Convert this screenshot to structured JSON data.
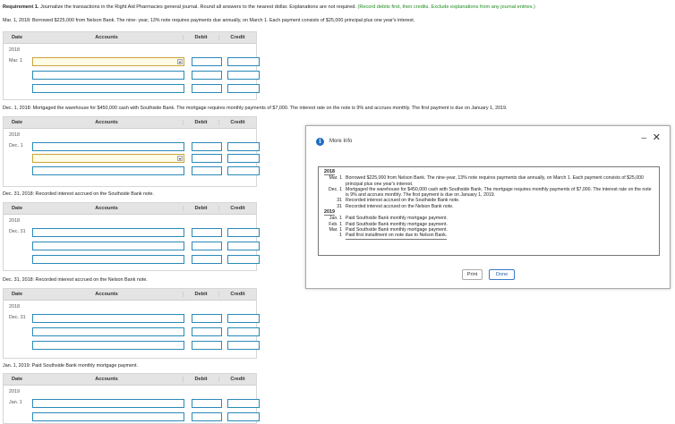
{
  "requirement": {
    "label": "Requirement 1.",
    "text": " Journalize the transactions in the Right Aid Pharmacies general journal. Round all answers to the nearest dollar. Explanations are not required.",
    "hint": "(Record debits first, then credits. Exclude explanations from any journal entries.)"
  },
  "table_headers": {
    "date": "Date",
    "accounts": "Accounts",
    "debit": "Debit",
    "credit": "Credit"
  },
  "entries": [
    {
      "prompt": "Mar. 1, 2018: Borrowed $225,000 from Nelson Bank. The nine- year, 13% note requires payments due annually, on March 1. Each payment consists of $25,000 principal plus one year's interest.",
      "year": "2018",
      "day": "Mar. 1"
    },
    {
      "prompt": "Dec. 1, 2018: Mortgaged the warehouse for $450,000 cash with Southside Bank. The mortgage requires monthly payments of $7,000. The interest rate on the note is 9% and accrues monthly. The first payment is due on January 1, 2019.",
      "year": "2018",
      "day": "Dec. 1"
    },
    {
      "prompt": "Dec. 31, 2018: Recorded interest accrued on the Southside Bank note.",
      "year": "2018",
      "day": "Dec. 31"
    },
    {
      "prompt": "Dec. 31, 2018: Recorded interest accrued on the Nelson Bank note.",
      "year": "2018",
      "day": "Dec. 31"
    },
    {
      "prompt": "Jan. 1, 2019: Paid Southside Bank monthly mortgage payment.",
      "year": "2019",
      "day": "Jan. 1"
    }
  ],
  "modal": {
    "title": "More Info",
    "minimize": "–",
    "close": "✕",
    "year1": "2018",
    "events1": [
      {
        "date": "Mar. 1",
        "text": "Borrowed $225,000 from Nelson Bank. The nine-year, 13% note requires payments due annually, on March 1. Each payment consists of $25,000 principal plus one year's interest."
      },
      {
        "date": "Dec. 1",
        "text": "Mortgaged the warehouse for $450,000 cash with Southside Bank. The mortgage requires monthly payments of $7,000. The interest rate on the note is 9% and accrues monthly. The first payment is due on January 1, 2019."
      },
      {
        "date": "31",
        "text": "Recorded interest accrued on the Southside Bank note."
      },
      {
        "date": "31",
        "text": "Recorded interest accrued on the Nelson Bank note."
      }
    ],
    "year2": "2019",
    "events2": [
      {
        "date": "Jan. 1",
        "text": "Paid Southside Bank monthly mortgage payment."
      },
      {
        "date": "Feb. 1",
        "text": "Paid Southside Bank monthly mortgage payment."
      },
      {
        "date": "Mar. 1",
        "text": "Paid Southside Bank monthly mortgage payment."
      },
      {
        "date": "1",
        "text": "Paid first installment on note due to Nelson Bank."
      }
    ],
    "print_label": "Print",
    "done_label": "Done"
  },
  "colors": {
    "input_border": "#2a8ab8",
    "hint_green": "#1e8c1e",
    "info_blue": "#1f6fbf"
  },
  "icons": {
    "dropdown": "chevron-down-icon",
    "info": "info-icon"
  }
}
